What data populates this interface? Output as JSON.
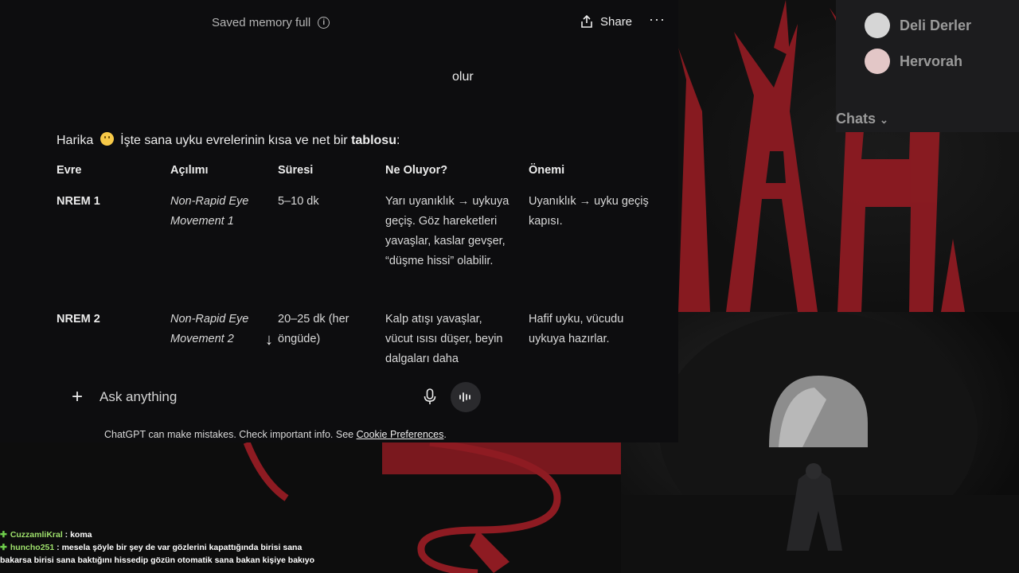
{
  "chatgpt": {
    "memory_status": "Saved memory full",
    "share_label": "Share",
    "more_label": "···",
    "user_message": "olur",
    "intro_prefix": "Harika",
    "intro_middle": "İşte sana uyku evrelerinin kısa ve net bir",
    "intro_bold": "tablosu",
    "intro_suffix": ":",
    "table": {
      "headers": [
        "Evre",
        "Açılımı",
        "Süresi",
        "Ne Oluyor?",
        "Önemi"
      ],
      "rows": [
        {
          "evre": "NREM 1",
          "acilim": "Non-Rapid Eye Movement 1",
          "sure": "5–10 dk",
          "ne_oluyor": "Yarı uyanıklık → uykuya geçiş. Göz hareketleri yavaşlar, kaslar gevşer, “düşme hissi” olabilir.",
          "onemi": "Uyanıklık → uyku geçiş kapısı."
        },
        {
          "evre": "NREM 2",
          "acilim": "Non-Rapid Eye Movement 2",
          "sure": "20–25 dk (her öngüde)",
          "ne_oluyor": "Kalp atışı yavaşlar, vücut ısısı düşer, beyin dalgaları daha",
          "onemi": "Hafif uyku, vücudu uykuya hazırlar."
        }
      ]
    },
    "composer_placeholder": "Ask anything",
    "disclaimer_text": "ChatGPT can make mistakes. Check important info. See",
    "disclaimer_link": "Cookie Preferences",
    "disclaimer_end": "."
  },
  "sidebar": {
    "items": [
      {
        "label": "Deli Derler"
      },
      {
        "label": "Hervorah"
      }
    ],
    "section_label": "Chats"
  },
  "stream_chat": [
    {
      "user": "CuzzamliKral",
      "message": ": koma"
    },
    {
      "user": "huncho251",
      "message": ": mesela şöyle bir şey de var gözlerini kapattığında birisi sana"
    },
    {
      "user": "",
      "message": "bakarsa birisi sana baktığını hissedip gözün otomatik sana bakan kişiye bakıyo"
    }
  ],
  "colors": {
    "art_red": "#8e1b22",
    "background": "#0d0d0f",
    "chat_user_green": "#9ee06b"
  }
}
